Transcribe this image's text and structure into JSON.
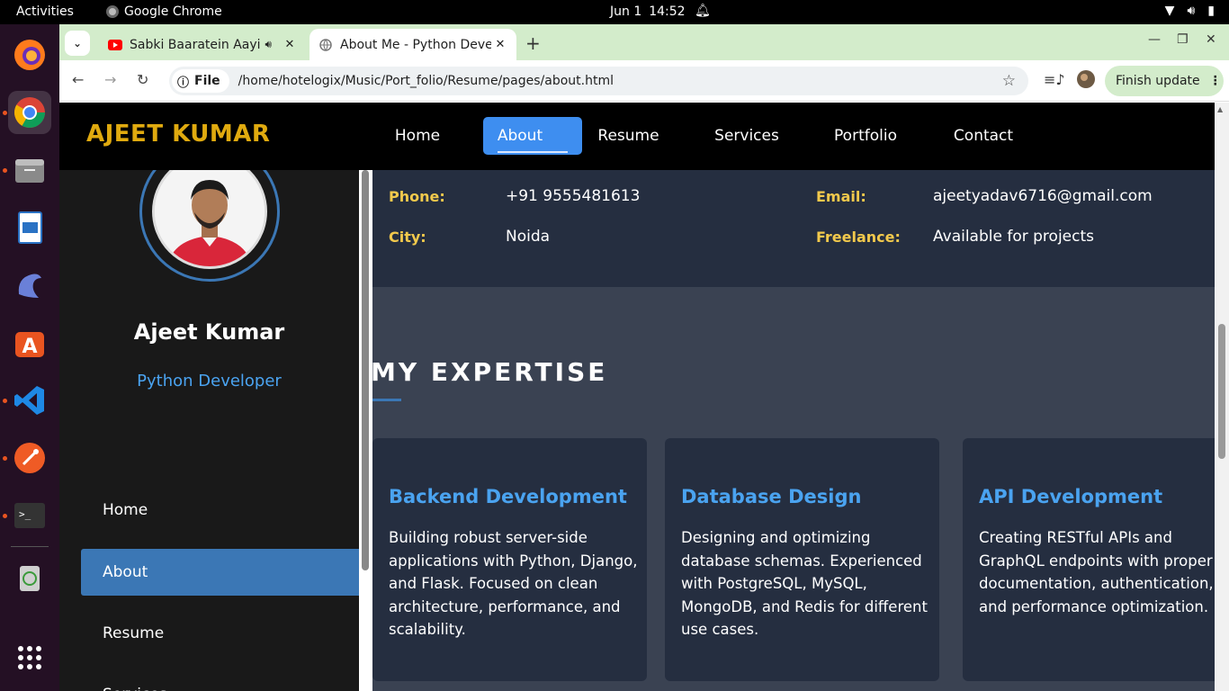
{
  "system": {
    "activities": "Activities",
    "app_name": "Google Chrome",
    "date": "Jun 1",
    "time": "14:52"
  },
  "dock": {
    "items": [
      "firefox-icon",
      "chrome-icon",
      "files-icon",
      "writer-icon",
      "dolphin-icon",
      "app-store-icon",
      "vscode-icon",
      "postman-icon",
      "terminal-icon",
      "trash-icon",
      "app-grid-icon"
    ]
  },
  "browser": {
    "tabs": [
      {
        "title": "Sabki Baaratein Aayi -",
        "favicon": "youtube-icon"
      },
      {
        "title": "About Me - Python Deve",
        "favicon": "globe-icon"
      }
    ],
    "omnibox": {
      "scheme_chip": "File",
      "url": "/home/hotelogix/Music/Port_folio/Resume/pages/about.html"
    },
    "finish_update": "Finish update"
  },
  "site": {
    "logo": "AJEET KUMAR",
    "nav": [
      "Home",
      "About",
      "Resume",
      "Services",
      "Portfolio",
      "Contact"
    ],
    "profile": {
      "name": "Ajeet Kumar",
      "role": "Python Developer"
    },
    "sidebar_nav": [
      "Home",
      "About",
      "Resume",
      "Services"
    ],
    "info": {
      "phone_label": "Phone:",
      "phone": "+91 9555481613",
      "city_label": "City:",
      "city": "Noida",
      "email_label": "Email:",
      "email": "ajeetyadav6716@gmail.com",
      "freelance_label": "Freelance:",
      "freelance": "Available for projects"
    },
    "expertise": {
      "title": "MY EXPERTISE",
      "cards": [
        {
          "title": "Backend Development",
          "text": "Building robust server-side applications with Python, Django, and Flask. Focused on clean architecture, performance, and scalability."
        },
        {
          "title": "Database Design",
          "text": "Designing and optimizing database schemas. Experienced with PostgreSQL, MySQL, MongoDB, and Redis for different use cases."
        },
        {
          "title": "API Development",
          "text": "Creating RESTful APIs and GraphQL endpoints with proper documentation, authentication, and performance optimization."
        }
      ]
    }
  },
  "colors": {
    "accent": "#3e8ef0",
    "logo": "#e0aa0f",
    "label": "#f2c94c",
    "card": "#252e40"
  }
}
